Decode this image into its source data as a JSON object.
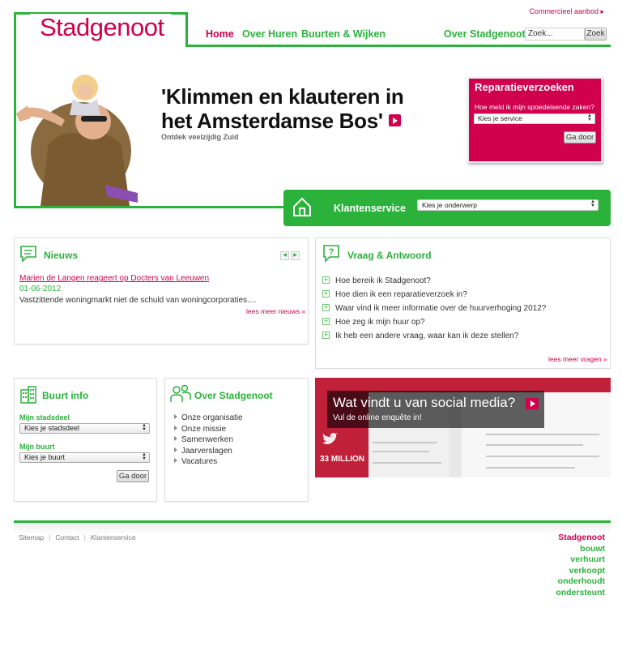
{
  "header": {
    "top_link": "Commercieel aanbod ▸",
    "logo": "Stadgenoot",
    "nav": [
      "Home",
      "Over Huren",
      "Buurten & Wijken",
      "Over Stadgenoot"
    ],
    "search_placeholder": "Zoek...",
    "search_button": "Zoek"
  },
  "hero": {
    "title": "'Klimmen en klauteren in het Amsterdamse Bos'",
    "subtitle": "Ontdek veelzijdig Zuid"
  },
  "reparatie": {
    "title": "Reparatieverzoeken",
    "question": "Hoe meld ik mijn spoedeisende zaken?",
    "select_value": "Kies je service",
    "button": "Ga door"
  },
  "klantenservice": {
    "label": "Klantenservice",
    "select_value": "Kies je onderwerp"
  },
  "nieuws": {
    "title": "Nieuws",
    "link": "Marien de Langen reageert op Docters van Leeuwen",
    "date": "01-06-2012",
    "text": "Vastzittende woningmarkt niet de schuld van woningcorporaties....",
    "more": "lees meer nieuws »"
  },
  "qa": {
    "title": "Vraag & Antwoord",
    "items": [
      "Hoe bereik ik Stadgenoot?",
      "Hoe dien ik een reparatieverzoek in?",
      "Waar vind ik meer informatie over de huurverhoging 2012?",
      "Hoe zeg ik mijn huur op?",
      "Ik heb een andere vraag, waar kan ik deze stellen?"
    ],
    "more": "lees meer vragen »"
  },
  "buurt": {
    "title": "Buurt info",
    "label1": "Mijn stadsdeel",
    "select1": "Kies je stadsdeel",
    "label2": "Mijn buurt",
    "select2": "Kies je buurt",
    "button": "Ga door"
  },
  "over": {
    "title": "Over Stadgenoot",
    "items": [
      "Onze organisatie",
      "Onze missie",
      "Samenwerken",
      "Jaarverslagen",
      "Vacatures"
    ]
  },
  "social": {
    "title": "Wat vindt u van social media?",
    "subtitle": "Vul de online enquête in!",
    "big_text": "33 MILLION"
  },
  "footer": {
    "links": [
      "Sitemap",
      "Contact",
      "Klantenservice"
    ],
    "tagline": [
      "Stadgenoot",
      "bouwt",
      "verhuurt",
      "verkoopt",
      "onderhoudt",
      "ondersteunt"
    ]
  },
  "colors": {
    "green": "#2bb23b",
    "pink": "#d0004f"
  }
}
